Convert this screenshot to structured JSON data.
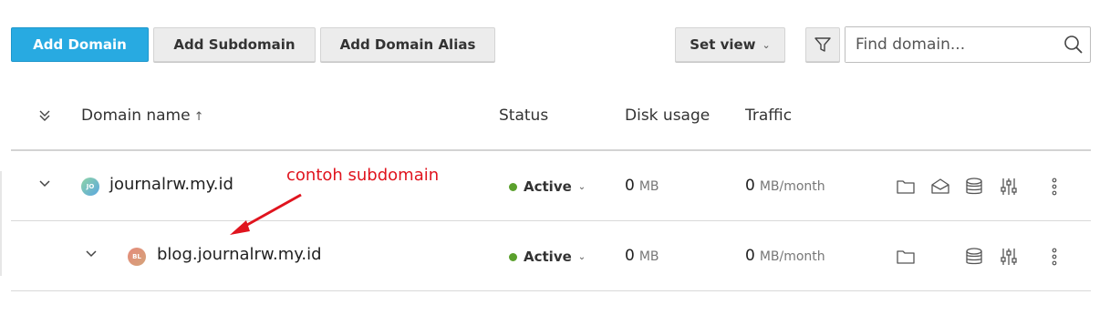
{
  "toolbar": {
    "add_domain": "Add Domain",
    "add_subdomain": "Add Subdomain",
    "add_domain_alias": "Add Domain Alias",
    "set_view": "Set view",
    "search_placeholder": "Find domain..."
  },
  "table": {
    "columns": {
      "domain_name": "Domain name",
      "status": "Status",
      "disk_usage": "Disk usage",
      "traffic": "Traffic"
    },
    "rows": [
      {
        "favicon_text": "JO",
        "name": "journalrw.my.id",
        "status": "Active",
        "disk_value": "0",
        "disk_unit": "MB",
        "traffic_value": "0",
        "traffic_unit": "MB/month"
      },
      {
        "favicon_text": "BL",
        "name": "blog.journalrw.my.id",
        "status": "Active",
        "disk_value": "0",
        "disk_unit": "MB",
        "traffic_value": "0",
        "traffic_unit": "MB/month"
      }
    ]
  },
  "annotation": {
    "text": "contoh subdomain",
    "color": "#e0141e"
  },
  "colors": {
    "primary": "#28aae1",
    "status_active": "#5aa02c"
  }
}
